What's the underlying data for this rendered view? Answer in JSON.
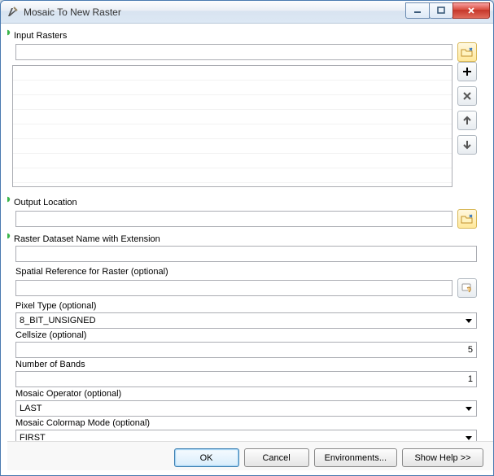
{
  "window": {
    "title": "Mosaic To New Raster"
  },
  "fields": {
    "input_rasters_label": "Input Rasters",
    "input_rasters_value": "",
    "output_location_label": "Output Location",
    "output_location_value": "",
    "dataset_name_label": "Raster Dataset Name with Extension",
    "dataset_name_value": "",
    "spatial_ref_label": "Spatial Reference for Raster (optional)",
    "spatial_ref_value": "",
    "pixel_type_label": "Pixel Type (optional)",
    "pixel_type_value": "8_BIT_UNSIGNED",
    "cellsize_label": "Cellsize (optional)",
    "cellsize_value": "5",
    "bands_label": "Number of Bands",
    "bands_value": "1",
    "mosaic_op_label": "Mosaic Operator (optional)",
    "mosaic_op_value": "LAST",
    "colormap_label": "Mosaic Colormap Mode (optional)",
    "colormap_value": "FIRST"
  },
  "buttons": {
    "ok": "OK",
    "cancel": "Cancel",
    "env": "Environments...",
    "help": "Show Help >>"
  }
}
